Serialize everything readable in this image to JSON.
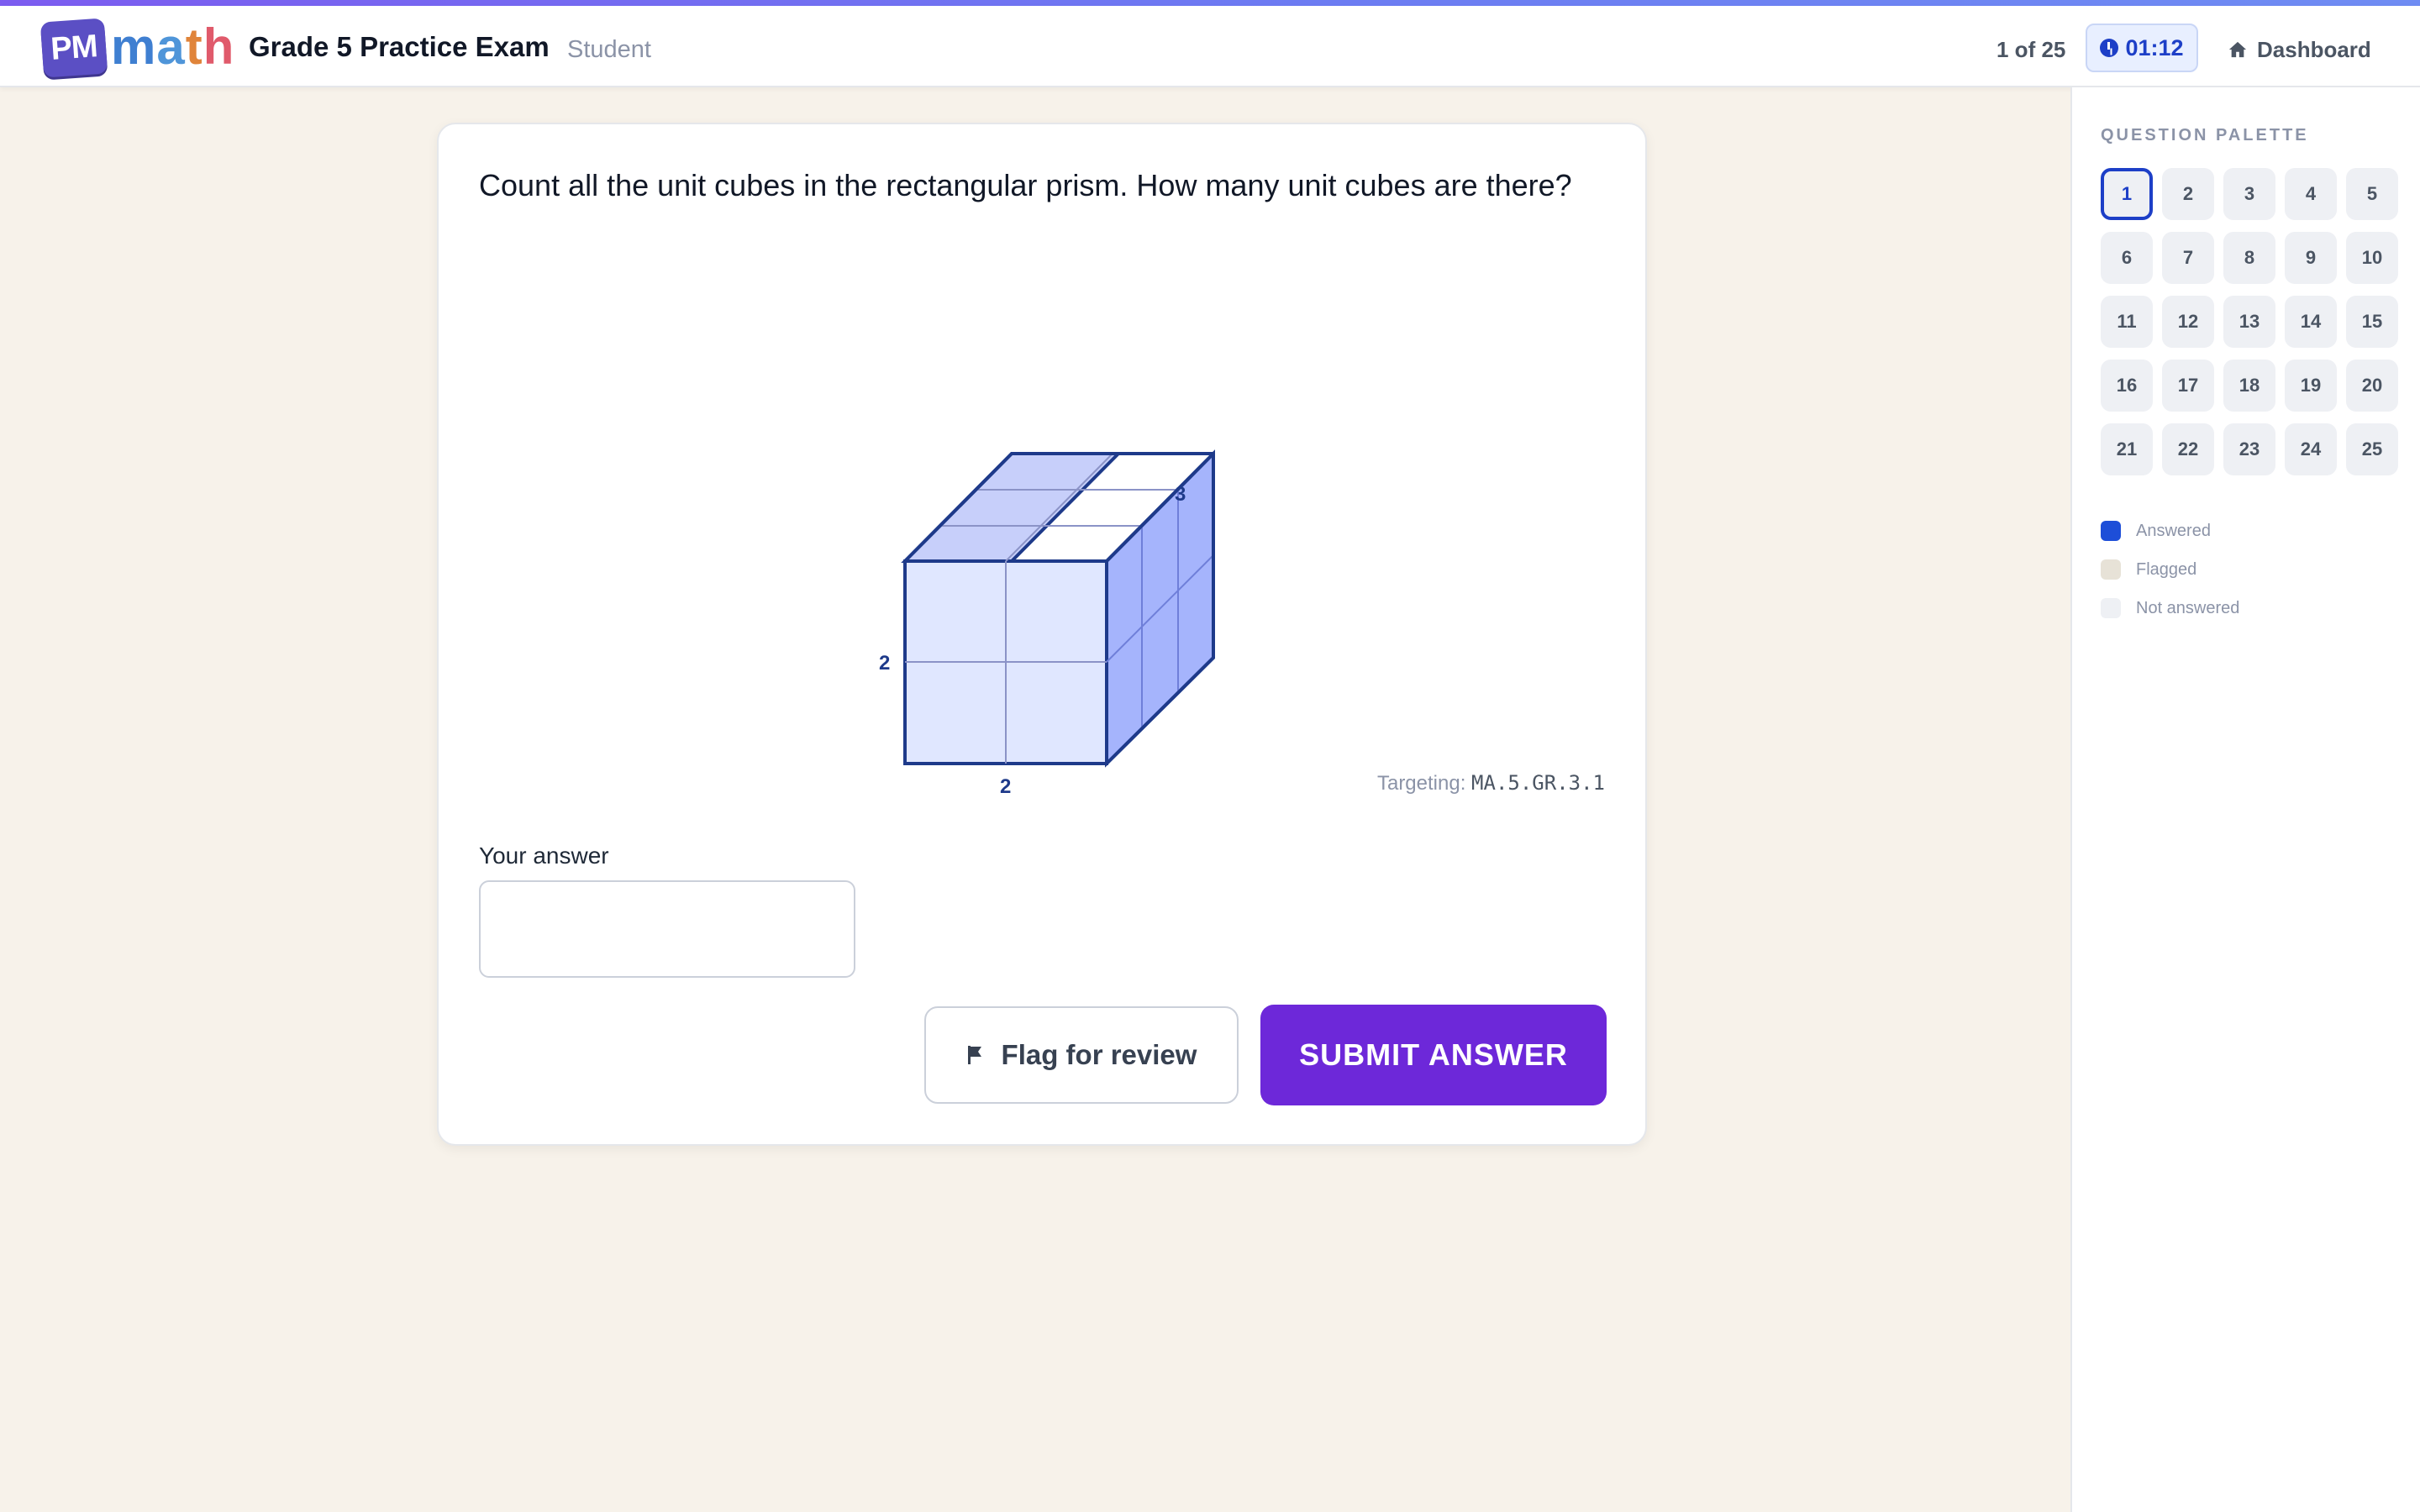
{
  "header": {
    "logo_badge": "PM",
    "logo_word": [
      "m",
      "a",
      "t",
      "h"
    ],
    "exam_title": "Grade 5 Practice Exam",
    "role": "Student",
    "progress": "1 of 25",
    "timer": "01:12",
    "dashboard_label": "Dashboard",
    "icons": {
      "timer": "clock-icon",
      "dashboard": "house-icon"
    }
  },
  "question": {
    "text": "Count all the unit cubes in the rectangular prism. How many unit cubes are there?",
    "figure": {
      "type": "rectangular-prism-unit-cubes",
      "labels": {
        "height": "2",
        "width": "2",
        "depth": "3"
      }
    },
    "targeting_label": "Targeting:",
    "targeting_code": "MA.5.GR.3.1"
  },
  "answer": {
    "label": "Your answer",
    "value": "",
    "placeholder": ""
  },
  "actions": {
    "flag_label": "Flag for review",
    "submit_label": "SUBMIT ANSWER",
    "icons": {
      "flag": "flag-icon"
    }
  },
  "palette": {
    "heading": "QUESTION PALETTE",
    "current": 1,
    "questions": [
      "1",
      "2",
      "3",
      "4",
      "5",
      "6",
      "7",
      "8",
      "9",
      "10",
      "11",
      "12",
      "13",
      "14",
      "15",
      "16",
      "17",
      "18",
      "19",
      "20",
      "21",
      "22",
      "23",
      "24",
      "25"
    ],
    "legend": [
      {
        "label": "Answered",
        "color": "#1d4ed8"
      },
      {
        "label": "Flagged",
        "color": "#e7e2d7"
      },
      {
        "label": "Not answered",
        "color": "#eef0f4"
      }
    ]
  },
  "colors": {
    "accent": "#6d28d9",
    "timer": "#1d3fc7",
    "page_bg": "#f7f2ea"
  }
}
